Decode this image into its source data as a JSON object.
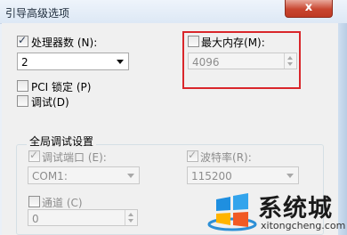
{
  "window": {
    "title": "引导高级选项",
    "close_label": "x"
  },
  "processor": {
    "label": "处理器数",
    "accel": "(N)",
    "colon": ":",
    "checked": true,
    "value": "2"
  },
  "pci_lock": {
    "label": "PCI 锁定",
    "accel": "(P)",
    "checked": false
  },
  "debug": {
    "label": "调试",
    "accel": "(D)",
    "checked": false
  },
  "max_memory": {
    "label": "最大内存",
    "accel": "(M)",
    "colon": ":",
    "checked": false,
    "value": "4096"
  },
  "global_debug": {
    "title": "全局调试设置",
    "debug_port": {
      "label": "调试端口",
      "accel": "(E)",
      "colon": ":",
      "checked": true,
      "value": "COM1:"
    },
    "baud_rate": {
      "label": "波特率",
      "accel": "(R)",
      "colon": ":",
      "checked": true,
      "value": "115200"
    },
    "channel": {
      "label": "通道",
      "accel": "(C)",
      "checked": false,
      "value": "0"
    }
  },
  "watermark": {
    "brand": "系统城",
    "url": "xitongcheng.com"
  },
  "colors": {
    "highlight": "#d9262b",
    "title_bar": "#dde8f5",
    "dialog_bg": "#f0f0f0"
  }
}
